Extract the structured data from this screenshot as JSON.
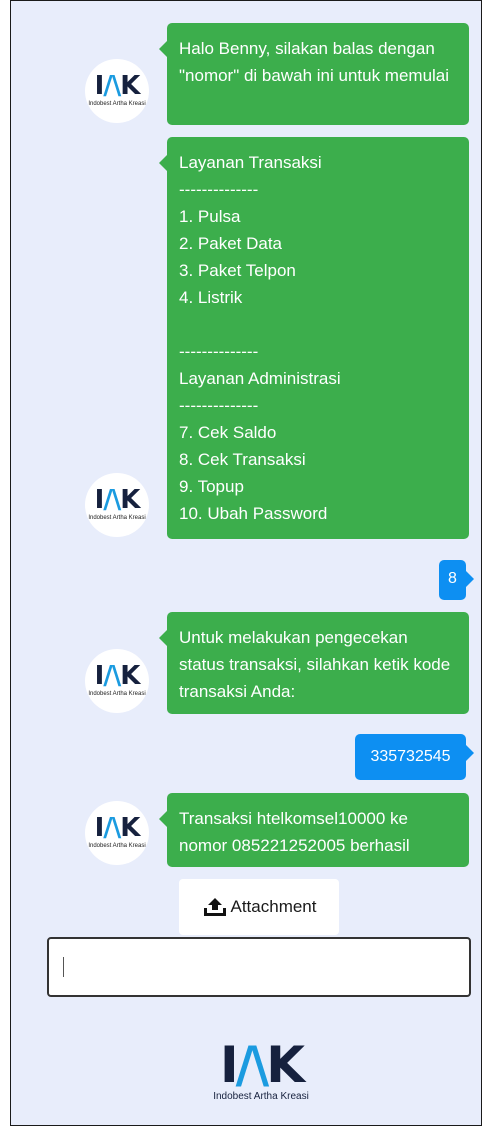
{
  "messages": {
    "m1": {
      "text": "Halo Benny, silakan balas dengan \"nomor\" di bawah ini untuk memulai"
    },
    "m2": {
      "lines": [
        "Layanan Transaksi",
        "--------------",
        "1. Pulsa",
        "2. Paket Data",
        "3. Paket Telpon",
        "4. Listrik",
        "",
        "--------------",
        "Layanan Administrasi",
        "--------------",
        "7. Cek Saldo",
        "8. Cek Transaksi",
        "9. Topup",
        "10. Ubah Password"
      ]
    },
    "r1": {
      "text": "8"
    },
    "m3": {
      "text": "Untuk melakukan pengecekan status transaksi, silahkan ketik kode transaksi Anda:"
    },
    "r2": {
      "text": "335732545"
    },
    "m4": {
      "text": "Transaksi htelkomsel10000 ke nomor 085221252005 berhasil"
    }
  },
  "avatar": {
    "logo_main": "IAK",
    "logo_sub": "Indobest Artha Kreasi"
  },
  "attachment": {
    "label": "Attachment",
    "icon": "upload-icon"
  },
  "input": {
    "value": "",
    "placeholder": ""
  },
  "footer": {
    "logo_main": "IAK",
    "logo_sub": "Indobest Artha Kreasi"
  },
  "colors": {
    "bot_bubble": "#3cae4c",
    "user_bubble": "#0d8ff2",
    "background": "#e8edfb",
    "logo_dark": "#16213e",
    "logo_accent": "#1b9be0"
  }
}
